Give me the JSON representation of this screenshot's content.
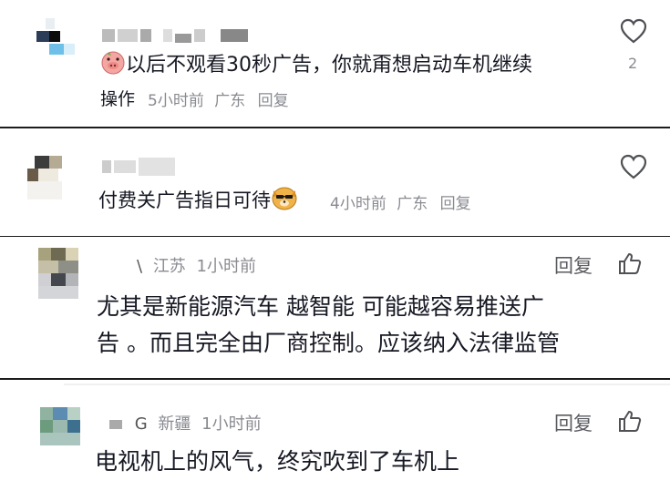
{
  "comments": [
    {
      "text": "以后不观看30秒广告，你就甭想启动车机继续操作",
      "text_line1": "以后不观看30秒广告，你就甭想启动车机继续",
      "text_line2": "操作",
      "time": "5小时前",
      "location": "广东",
      "reply_label": "回复",
      "like_count": "2",
      "emoji": "pig-face-emoji"
    },
    {
      "text": "付费关广告指日可待",
      "time": "4小时前",
      "location": "广东",
      "reply_label": "回复",
      "emoji": "cool-dog-emoji"
    },
    {
      "name_fragment": "\\",
      "location": "江苏",
      "time": "1小时前",
      "reply_label": "回复",
      "text_line1": "尤其是新能源汽车 越智能 可能越容易推送广",
      "text_line2": "告 。而且完全由厂商控制。应该纳入法律监管"
    },
    {
      "name_fragment": "G",
      "location": "新疆",
      "time": "1小时前",
      "reply_label": "回复",
      "text": "电视机上的风气，终究吹到了车机上"
    }
  ],
  "colors": {
    "text": "#161823",
    "meta": "#8a8b91",
    "divider": "#1c1c1c"
  }
}
